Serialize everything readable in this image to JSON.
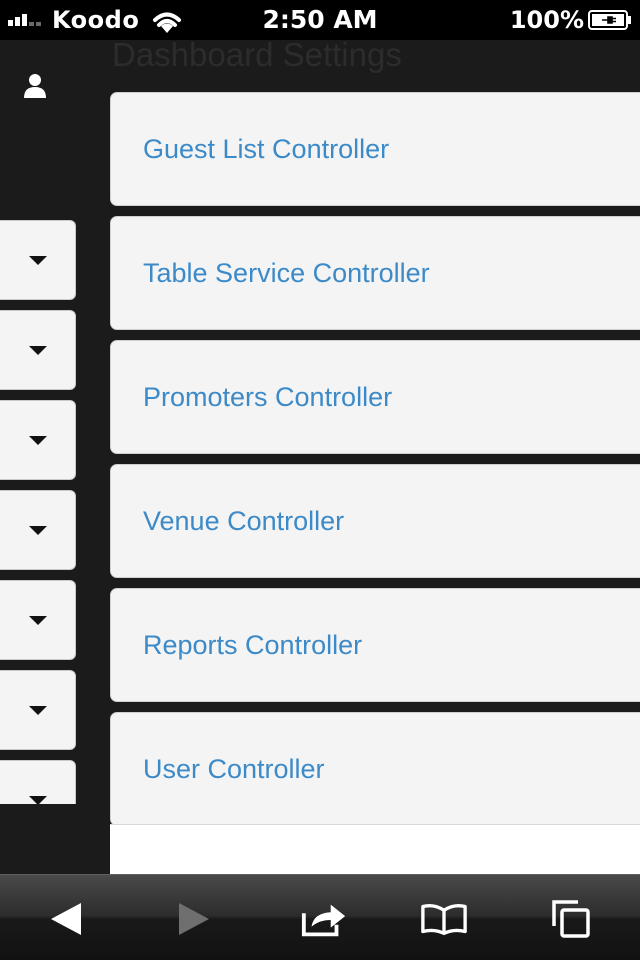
{
  "status_bar": {
    "carrier": "Koodo",
    "time": "2:50 AM",
    "battery_percent": "100%",
    "signal_bars": 3
  },
  "header": {
    "title": "Dashboard Settings"
  },
  "panels": [
    {
      "label": "Guest List Controller"
    },
    {
      "label": "Table Service Controller"
    },
    {
      "label": "Promoters Controller"
    },
    {
      "label": "Venue Controller"
    },
    {
      "label": "Reports Controller"
    },
    {
      "label": "User Controller"
    }
  ],
  "sidebar": {
    "icons": [
      "user-icon"
    ],
    "dropdown_count": 7
  },
  "toolbar": {
    "buttons": [
      "back-icon",
      "forward-icon",
      "share-icon",
      "bookmarks-icon",
      "tabs-icon"
    ]
  },
  "colors": {
    "link": "#3c8ac7",
    "panel_bg": "#f4f4f4",
    "app_bg": "#1b1b1b"
  }
}
